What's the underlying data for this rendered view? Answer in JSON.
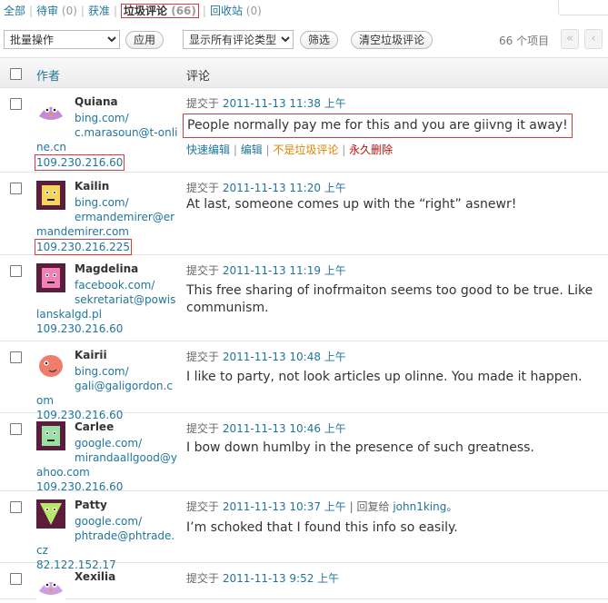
{
  "filters": [
    {
      "label": "全部",
      "count": "",
      "current": false
    },
    {
      "label": "待审",
      "count": "(0)",
      "current": false
    },
    {
      "label": "获准",
      "count": "",
      "current": false
    },
    {
      "label": "垃圾评论",
      "count": "(66)",
      "current": true
    },
    {
      "label": "回收站",
      "count": "(0)",
      "current": false
    }
  ],
  "toolbar": {
    "bulk_select": "批量操作",
    "apply_label": "应用",
    "type_select": "显示所有评论类型",
    "filter_label": "筛选",
    "empty_spam_label": "清空垃圾评论",
    "items_count": "66 个项目",
    "first_page": "«",
    "prev_page": "‹"
  },
  "table": {
    "col_author": "作者",
    "col_comment": "评论"
  },
  "rows": [
    {
      "name": "Quiana",
      "site": "bing.com/",
      "email": "c.marasoun@t-online.cn",
      "ip": "109.230.216.60",
      "submitted_prefix": "提交于",
      "date": "2011-11-13 11:38 上午",
      "reply": "",
      "reply_to": "",
      "comment": "People normally pay me for this and you are giivng it away!",
      "avatar_color": "#c48ad6",
      "avatar_face": "bird"
    },
    {
      "name": "Kailin",
      "site": "bing.com/",
      "email": "ermandemirer@ermandemirer.com",
      "ip": "109.230.216.225",
      "submitted_prefix": "提交于",
      "date": "2011-11-13 11:20 上午",
      "reply": "",
      "reply_to": "",
      "comment": "At last, someone comes up with the “right” asnewr!",
      "avatar_color": "#f6d35a",
      "avatar_face": "square"
    },
    {
      "name": "Magdelina",
      "site": "facebook.com/",
      "email": "sekretariat@powislanskalgd.pl",
      "ip": "109.230.216.60",
      "submitted_prefix": "提交于",
      "date": "2011-11-13 11:19 上午",
      "reply": "",
      "reply_to": "",
      "comment": "This free sharing of inofrmaiton seems too good to be true. Like communism.",
      "avatar_color": "#f27fb8",
      "avatar_face": "square"
    },
    {
      "name": "Kairii",
      "site": "bing.com/",
      "email": "gali@galigordon.com",
      "ip": "109.230.216.60",
      "submitted_prefix": "提交于",
      "date": "2011-11-13 10:48 上午",
      "reply": "",
      "reply_to": "",
      "comment": "I like to party, not look articles up olinne. You made it happen.",
      "avatar_color": "#ef7d6e",
      "avatar_face": "blob"
    },
    {
      "name": "Carlee",
      "site": "google.com/",
      "email": "mirandaallgood@yahoo.com",
      "ip": "109.230.216.60",
      "submitted_prefix": "提交于",
      "date": "2011-11-13 10:46 上午",
      "reply": "",
      "reply_to": "",
      "comment": "I bow down humlby in the presence of such greatness.",
      "avatar_color": "#9be0a4",
      "avatar_face": "square"
    },
    {
      "name": "Patty",
      "site": "google.com/",
      "email": "phtrade@phtrade.cz",
      "ip": "82.122.152.17",
      "submitted_prefix": "提交于",
      "date": "2011-11-13 10:37 上午",
      "reply": "| 回复给",
      "reply_to": "john1king。",
      "comment": "I’m schoked that I found this info so easily.",
      "avatar_color": "#b6e86a",
      "avatar_face": "triangle"
    },
    {
      "name": "Xexilia",
      "site": "",
      "email": "",
      "ip": "",
      "submitted_prefix": "提交于",
      "date": "2011-11-13 9:52 上午",
      "reply": "",
      "reply_to": "",
      "comment": "",
      "avatar_color": "#c9a0e0",
      "avatar_face": "bird"
    }
  ],
  "row_actions": {
    "quick_edit": "快速编辑",
    "edit": "编辑",
    "not_spam": "不是垃圾评论",
    "delete": "永久删除"
  }
}
